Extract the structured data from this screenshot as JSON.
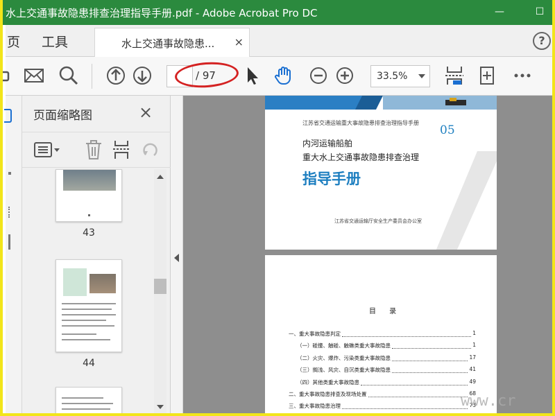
{
  "window": {
    "title": "水上交通事故隐患排查治理指导手册.pdf - Adobe Acrobat Pro DC",
    "minimize": "—",
    "maximize": "☐"
  },
  "menu": {
    "home": "页",
    "tools": "工具"
  },
  "doc_tab": {
    "label": "水上交通事故隐患...",
    "close": "×"
  },
  "help": "?",
  "toolbar": {
    "page_current": "",
    "page_total": "/ 97",
    "zoom": "33.5%"
  },
  "thumbnail_panel": {
    "title": "页面缩略图",
    "close": "×",
    "thumbs": [
      {
        "label": "43"
      },
      {
        "label": "44"
      }
    ]
  },
  "cover": {
    "subtitle": "江苏省交通运输重大事故隐患排查治理指导手册",
    "number": "05",
    "line1": "内河运输船舶",
    "line2": "重大水上交通事故隐患排查治理",
    "heading": "指导手册",
    "org": "江苏省交通运输厅安全生产委员会办公室"
  },
  "toc": {
    "title": "目 录",
    "rows": [
      {
        "text": "一、重大事故隐患判定",
        "page": "1",
        "indent": 0
      },
      {
        "text": "（一）碰撞、触碰、触礁类重大事故隐患",
        "page": "1",
        "indent": 1
      },
      {
        "text": "（二）火灾、爆炸、污染类重大事故隐患",
        "page": "17",
        "indent": 1
      },
      {
        "text": "（三）搁浅、风灾、自沉类重大事故隐患",
        "page": "41",
        "indent": 1
      },
      {
        "text": "（四）其他类重大事故隐患",
        "page": "49",
        "indent": 1
      },
      {
        "text": "二、重大事故隐患排查及现场处置",
        "page": "68",
        "indent": 0
      },
      {
        "text": "三、重大事故隐患治理",
        "page": "73",
        "indent": 0
      }
    ]
  },
  "watermark": "www.cr",
  "colors": {
    "titlebar": "#2b8a3e",
    "accent": "#1e7fc0",
    "highlight_oval": "#d42222",
    "frame": "#f2e51a"
  }
}
